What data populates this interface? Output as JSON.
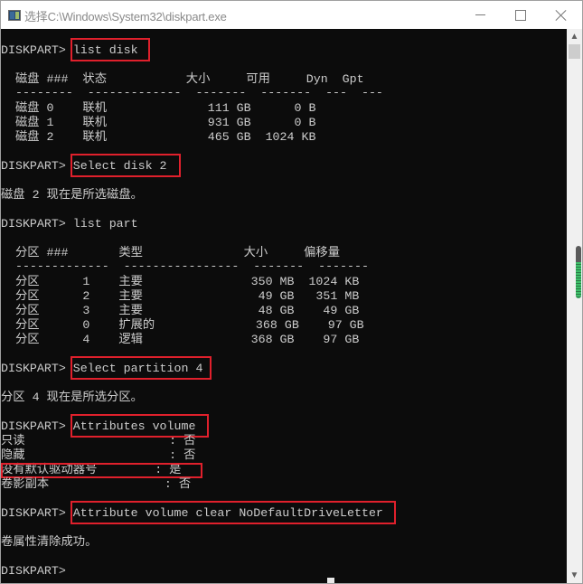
{
  "window": {
    "title": "选择C:\\Windows\\System32\\diskpart.exe",
    "icon": "console-app-icon",
    "controls": {
      "minimize": "minimize",
      "maximize": "maximize",
      "close": "close"
    }
  },
  "console": {
    "lines": [
      {
        "prompt": "DISKPART> ",
        "command": "list disk"
      },
      {
        "text": "  磁盘 ###  状态           大小     可用     Dyn  Gpt"
      },
      {
        "text": "  --------  -------------  -------  -------  ---  ---"
      },
      {
        "text": "  磁盘 0    联机              111 GB      0 B"
      },
      {
        "text": "  磁盘 1    联机              931 GB      0 B"
      },
      {
        "text": "  磁盘 2    联机              465 GB  1024 KB"
      },
      {
        "prompt": "DISKPART> ",
        "command": "Select disk 2"
      },
      {
        "text": "磁盘 2 现在是所选磁盘。"
      },
      {
        "prompt": "DISKPART> ",
        "command": "list part"
      },
      {
        "text": "  分区 ###       类型              大小     偏移量"
      },
      {
        "text": "  -------------  ----------------  -------  -------"
      },
      {
        "text": "  分区      1    主要               350 MB  1024 KB"
      },
      {
        "text": "  分区      2    主要                49 GB   351 MB"
      },
      {
        "text": "  分区      3    主要                48 GB    49 GB"
      },
      {
        "text": "  分区      0    扩展的              368 GB    97 GB"
      },
      {
        "text": "  分区      4    逻辑               368 GB    97 GB"
      },
      {
        "prompt": "DISKPART> ",
        "command": "Select partition 4"
      },
      {
        "text": "分区 4 现在是所选分区。"
      },
      {
        "prompt": "DISKPART> ",
        "command": "Attributes volume"
      },
      {
        "text": "只读                    : 否"
      },
      {
        "text": "隐藏                    : 否"
      },
      {
        "text": "没有默认驱动器号        : 是"
      },
      {
        "text": "卷影副本                : 否"
      },
      {
        "prompt": "DISKPART> ",
        "command": "Attribute volume clear NoDefaultDriveLetter"
      },
      {
        "text": "卷属性清除成功。"
      },
      {
        "prompt": "DISKPART> ",
        "command": ""
      }
    ],
    "highlight_color": "#e0202c",
    "text_color": "#cccccc",
    "background_color": "#0c0c0c"
  },
  "scrollbar": {
    "thumb_color": "#5a5a5a",
    "indicator_color": "#3fbf6a"
  }
}
